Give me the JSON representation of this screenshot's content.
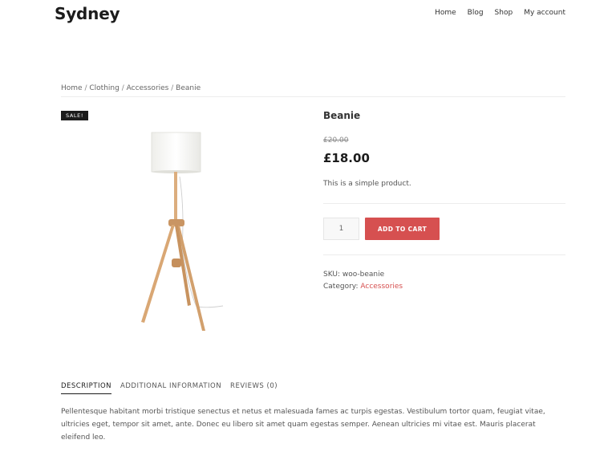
{
  "header": {
    "site_title": "Sydney",
    "nav": [
      "Home",
      "Blog",
      "Shop",
      "My account"
    ]
  },
  "breadcrumb": {
    "items": [
      "Home",
      "Clothing",
      "Accessories",
      "Beanie"
    ],
    "separator": "/"
  },
  "product": {
    "badge": "SALE!",
    "title": "Beanie",
    "old_price": "£20.00",
    "price": "£18.00",
    "short_description": "This is a simple product.",
    "quantity": "1",
    "add_to_cart_label": "ADD TO CART",
    "sku_label": "SKU:",
    "sku": "woo-beanie",
    "category_label": "Category:",
    "category": "Accessories",
    "image_icon": "floor-lamp-icon"
  },
  "tabs": [
    {
      "label": "DESCRIPTION",
      "active": true
    },
    {
      "label": "ADDITIONAL INFORMATION",
      "active": false
    },
    {
      "label": "REVIEWS (0)",
      "active": false
    }
  ],
  "description": "Pellentesque habitant morbi tristique senectus et netus et malesuada fames ac turpis egestas. Vestibulum tortor quam, feugiat vitae, ultricies eget, tempor sit amet, ante. Donec eu libero sit amet quam egestas semper. Aenean ultricies mi vitae est. Mauris placerat eleifend leo.",
  "colors": {
    "accent": "#d65050",
    "badge_bg": "#1b1b1b",
    "title": "#1c1c1c"
  }
}
